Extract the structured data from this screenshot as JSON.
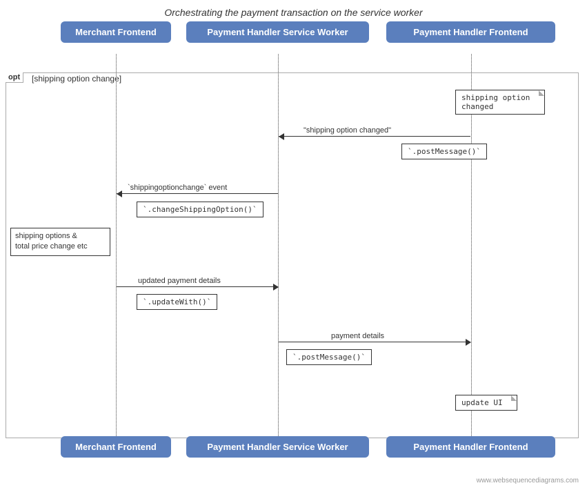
{
  "title": "Orchestrating the payment transaction on the service worker",
  "actors": {
    "merchant": "Merchant Frontend",
    "payment_sw": "Payment Handler Service Worker",
    "payment_frontend": "Payment Handler Frontend"
  },
  "opt_label": "opt",
  "opt_condition": "[shipping option change]",
  "messages": [
    {
      "id": "msg1",
      "text": "shipping option changed",
      "type": "note"
    },
    {
      "id": "msg2",
      "text": "\"shipping option changed\"",
      "type": "arrow_left"
    },
    {
      "id": "msg3",
      "text": "`.postMessage()`",
      "type": "note_box"
    },
    {
      "id": "msg4",
      "text": "`shippingoptionchange` event",
      "type": "arrow_left"
    },
    {
      "id": "msg5",
      "text": "`.changeShippingOption()`",
      "type": "note_box"
    },
    {
      "id": "msg6",
      "text": "shipping options &\ntotal price change etc",
      "type": "side_note"
    },
    {
      "id": "msg7",
      "text": "updated payment details",
      "type": "arrow_right"
    },
    {
      "id": "msg8",
      "text": "`.updateWith()`",
      "type": "note_box"
    },
    {
      "id": "msg9",
      "text": "payment details",
      "type": "arrow_right"
    },
    {
      "id": "msg10",
      "text": "`.postMessage()`",
      "type": "note_box"
    },
    {
      "id": "msg11",
      "text": "update UI",
      "type": "note"
    }
  ],
  "watermark": "www.websequencediagrams.com"
}
